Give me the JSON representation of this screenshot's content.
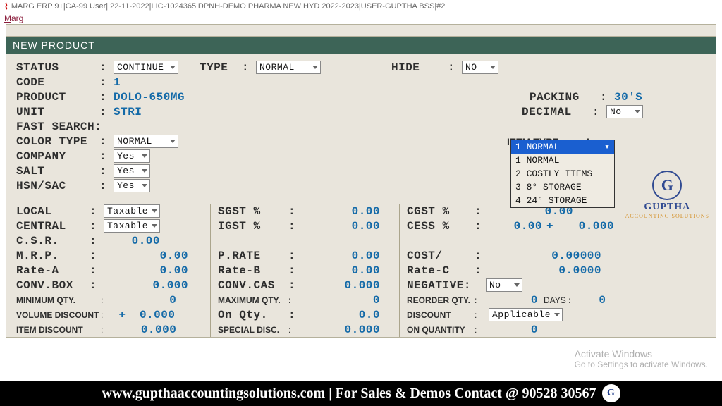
{
  "titlebar": "MARG ERP 9+|CA-99 User| 22-11-2022|LIC-1024365|DPNH-DEMO PHARMA NEW HYD 2022-2023|USER-GUPTHA BSS|#2",
  "menubar": "Marg",
  "panel_title": "NEW PRODUCT",
  "fields": {
    "status_lbl": "STATUS",
    "status_val": "CONTINUE",
    "type_lbl": "TYPE",
    "type_val": "NORMAL",
    "hide_lbl": "HIDE",
    "hide_val": "NO",
    "code_lbl": "CODE",
    "code_val": "1",
    "packing_lbl": "PACKING",
    "packing_val": "30'S",
    "product_lbl": "PRODUCT",
    "product_val": "DOLO-650MG",
    "unit_lbl": "UNIT",
    "unit_val": "STRI",
    "decimal_lbl": "DECIMAL",
    "decimal_val": "No",
    "fast_lbl": "FAST SEARCH:",
    "color_lbl": "COLOR TYPE",
    "color_val": "NORMAL",
    "itemtype_lbl": "ITEM TYPE",
    "company_lbl": "COMPANY",
    "company_val": "Yes",
    "salt_lbl": "SALT",
    "salt_val": "Yes",
    "hsn_lbl": "HSN/SAC",
    "hsn_val": "Yes"
  },
  "dropdown": {
    "selected": "1 NORMAL",
    "opts": [
      "1 NORMAL",
      "2 COSTLY ITEMS",
      "3 8° STORAGE",
      "4 24° STORAGE"
    ]
  },
  "tax": {
    "local_lbl": "LOCAL",
    "local_val": "Taxable",
    "central_lbl": "CENTRAL",
    "central_val": "Taxable",
    "csr_lbl": "C.S.R.",
    "csr_val": "0.00",
    "mrp_lbl": "M.R.P.",
    "mrp_val": "0.00",
    "ratea_lbl": "Rate-A",
    "ratea_val": "0.00",
    "convbox_lbl": "CONV.BOX",
    "convbox_val": "0.000",
    "minqty_lbl": "MINIMUM QTY.",
    "minqty_val": "0",
    "voldisc_lbl": "VOLUME DISCOUNT",
    "voldisc_plus": "+",
    "voldisc_val": "0.000",
    "itemdisc_lbl": "ITEM DISCOUNT",
    "itemdisc_val": "0.000",
    "sgst_lbl": "SGST %",
    "sgst_val": "0.00",
    "igst_lbl": "IGST %",
    "igst_val": "0.00",
    "prate_lbl": "P.RATE",
    "prate_val": "0.00",
    "rateb_lbl": "Rate-B",
    "rateb_val": "0.00",
    "convcas_lbl": "CONV.CAS",
    "convcas_val": "0.000",
    "maxqty_lbl": "MAXIMUM QTY.",
    "maxqty_val": "0",
    "onqty_lbl": "On Qty.",
    "onqty_val": "0.0",
    "specdisc_lbl": "SPECIAL DISC.",
    "specdisc_val": "0.000",
    "cgst_lbl": "CGST %",
    "cgst_val": "0.00",
    "cess_lbl": "CESS %",
    "cess_val1": "0.00",
    "cess_plus": "+",
    "cess_val2": "0.000",
    "cost_lbl": "COST/",
    "cost_val": "0.00000",
    "ratec_lbl": "Rate-C",
    "ratec_val": "0.0000",
    "neg_lbl": "NEGATIVE:",
    "neg_val": "No",
    "reorder_lbl": "REORDER QTY.",
    "reorder_val": "0",
    "days_lbl": "DAYS :",
    "days_val": "0",
    "discount_lbl": "DISCOUNT",
    "discount_val": "Applicable",
    "onq_lbl": "ON QUANTITY",
    "onq_val": "0"
  },
  "watermark_brand": "GUPTHA",
  "watermark_sub": "ACCOUNTING SOLUTIONS",
  "activate": {
    "t1": "Activate Windows",
    "t2": "Go to Settings to activate Windows."
  },
  "footer": "www.gupthaaccountingsolutions.com | For Sales & Demos Contact @ 90528 30567"
}
